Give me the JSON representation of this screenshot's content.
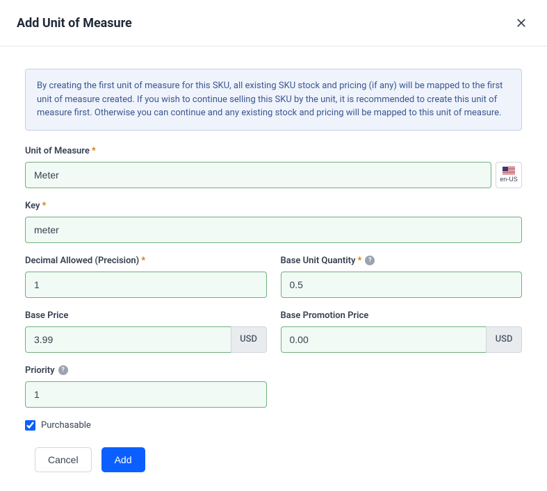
{
  "header": {
    "title": "Add Unit of Measure"
  },
  "info": {
    "text": "By creating the first unit of measure for this SKU, all existing SKU stock and pricing (if any) will be mapped to the first unit of measure created. If you wish to continue selling this SKU by the unit, it is recommended to create this unit of measure first. Otherwise you can continue and any existing stock and pricing will be mapped to this unit of measure."
  },
  "fields": {
    "unitOfMeasure": {
      "label": "Unit of Measure",
      "value": "Meter"
    },
    "key": {
      "label": "Key",
      "value": "meter"
    },
    "precision": {
      "label": "Decimal Allowed (Precision)",
      "value": "1"
    },
    "baseUnitQuantity": {
      "label": "Base Unit Quantity",
      "value": "0.5"
    },
    "basePrice": {
      "label": "Base Price",
      "value": "3.99",
      "currency": "USD"
    },
    "basePromoPrice": {
      "label": "Base Promotion Price",
      "value": "0.00",
      "currency": "USD"
    },
    "priority": {
      "label": "Priority",
      "value": "1"
    },
    "purchasable": {
      "label": "Purchasable"
    }
  },
  "locale": {
    "code": "en-US"
  },
  "buttons": {
    "cancel": "Cancel",
    "add": "Add"
  },
  "symbols": {
    "required": "*",
    "help": "?"
  }
}
